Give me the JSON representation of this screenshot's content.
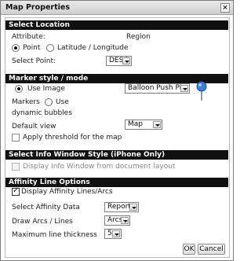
{
  "dialog": {
    "title": "Map Properties",
    "close_glyph": "×"
  },
  "select_location": {
    "header": "Select Location",
    "attribute_label": "Attribute:",
    "attribute_value": "Region",
    "point_label": "Point",
    "latlong_label": "Latitude / Longitude",
    "point_checked": true,
    "select_point_label": "Select Point:",
    "select_point_value": "DESC"
  },
  "marker_style": {
    "header": "Marker style / mode",
    "use_image_label": "Use Image",
    "use_image_checked": true,
    "image_value": "Balloon Push Pin",
    "pin_color": "#3b7fd6",
    "markers_label": "Markers",
    "use_label": "Use",
    "dynamic_bubbles_label": "dynamic bubbles",
    "default_view_label": "Default view",
    "default_view_value": "Map",
    "apply_threshold_label": "Apply threshold for the map",
    "apply_threshold_checked": false
  },
  "info_window": {
    "header": "Select Info Window Style (iPhone Only)",
    "display_label": "Display Info Window from document layout",
    "display_checked": false
  },
  "affinity": {
    "header": "Affinity Line Options",
    "display_label": "Display Affinity Lines/Arcs",
    "display_checked": true,
    "select_data_label": "Select Affinity Data",
    "select_data_value": "Report",
    "draw_label": "Draw Arcs / Lines",
    "draw_value": "Arcs",
    "thickness_label": "Maximum line thickness",
    "thickness_value": "5"
  },
  "buttons": {
    "ok": "OK",
    "cancel": "Cancel"
  }
}
